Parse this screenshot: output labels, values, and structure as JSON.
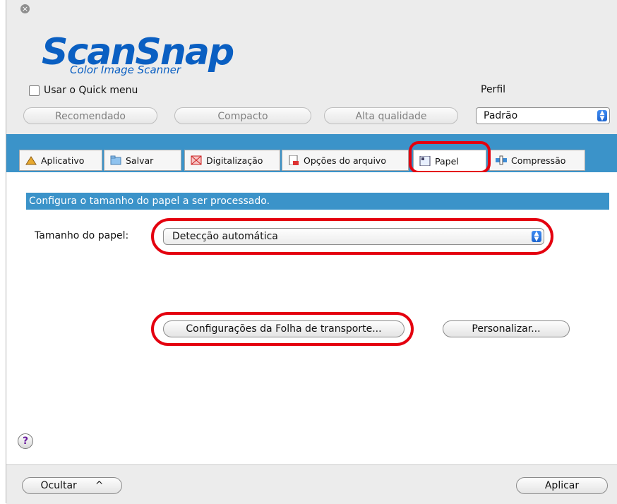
{
  "window": {
    "logo_main": "ScanSnap",
    "logo_sub": "Color Image Scanner"
  },
  "header": {
    "quick_menu_label": "Usar o Quick menu",
    "quick_menu_checked": false,
    "perfil_label": "Perfil",
    "profile_value": "Padrão",
    "presets": [
      "Recomendado",
      "Compacto",
      "Alta qualidade"
    ]
  },
  "tabs": [
    {
      "label": "Aplicativo",
      "icon": "app-icon"
    },
    {
      "label": "Salvar",
      "icon": "folder-icon"
    },
    {
      "label": "Digitalização",
      "icon": "scan-icon"
    },
    {
      "label": "Opções do arquivo",
      "icon": "file-icon"
    },
    {
      "label": "Papel",
      "icon": "paper-icon",
      "active": true
    },
    {
      "label": "Compressão",
      "icon": "compress-icon"
    }
  ],
  "main": {
    "description": "Configura o tamanho do papel a ser processado.",
    "paper_size_label": "Tamanho do papel:",
    "paper_size_value": "Detecção automática",
    "carrier_button": "Configurações da Folha de transporte...",
    "custom_button": "Personalizar...",
    "help": "?"
  },
  "footer": {
    "hide_button": "Ocultar",
    "hide_chevron": "^",
    "apply_button": "Aplicar"
  },
  "colors": {
    "accent_blue": "#3b93c9",
    "highlight_red": "#e4000f",
    "logo_blue": "#0a5fc2"
  }
}
